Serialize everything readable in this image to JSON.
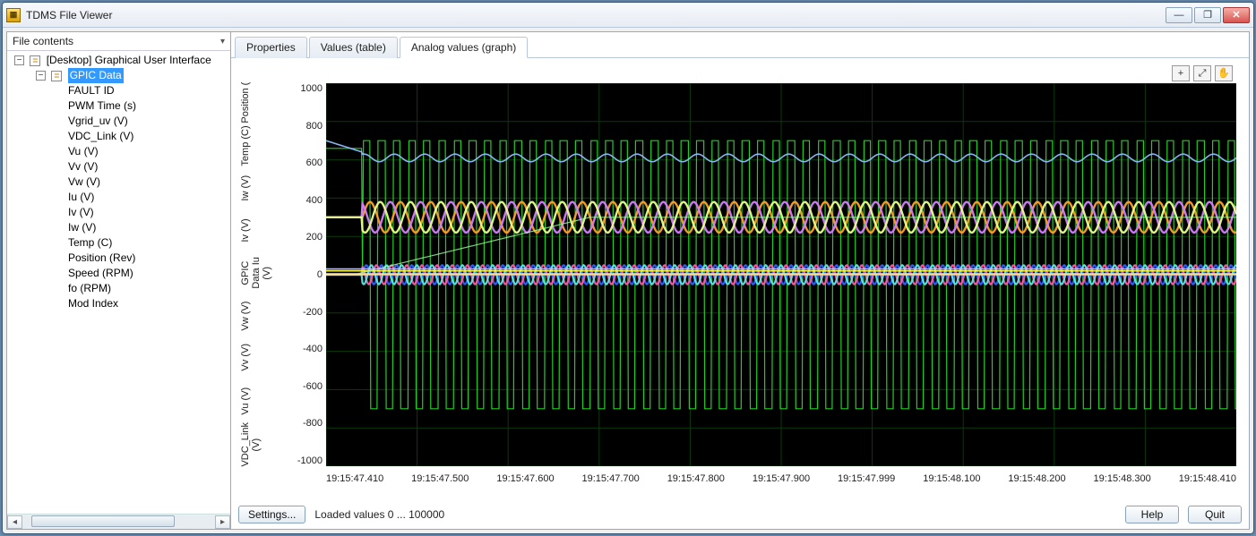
{
  "window": {
    "title": "TDMS File Viewer"
  },
  "sidebar": {
    "header": "File contents",
    "root": {
      "label": "[Desktop] Graphical User Interface"
    },
    "group": {
      "label": "GPIC Data",
      "selected": true
    },
    "leaves": [
      "FAULT ID",
      "PWM Time (s)",
      "Vgrid_uv (V)",
      "VDC_Link (V)",
      "Vu (V)",
      "Vv (V)",
      "Vw (V)",
      "Iu (V)",
      "Iv (V)",
      "Iw (V)",
      "Temp (C)",
      "Position (Rev)",
      "Speed (RPM)",
      "fo (RPM)",
      "Mod Index"
    ]
  },
  "tabs": [
    {
      "label": "Properties",
      "active": false
    },
    {
      "label": "Values (table)",
      "active": false
    },
    {
      "label": "Analog values (graph)",
      "active": true
    }
  ],
  "y_labels": [
    "Position (",
    "Temp (C)",
    "Iw (V)",
    "Iv (V)",
    "GPIC Data  Iu (V)",
    "Vw (V)",
    "Vv (V)",
    "Vu (V)",
    "VDC_Link (V)"
  ],
  "buttons": {
    "settings": "Settings...",
    "help": "Help",
    "quit": "Quit"
  },
  "status": "Loaded values 0 ... 100000",
  "chart_data": {
    "type": "line",
    "title": "",
    "ylim": [
      -1000,
      1000
    ],
    "x_range": [
      "19:15:47.410",
      "19:15:48.410"
    ],
    "x_ticks": [
      "19:15:47.410",
      "19:15:47.500",
      "19:15:47.600",
      "19:15:47.700",
      "19:15:47.800",
      "19:15:47.900",
      "19:15:47.999",
      "19:15:48.100",
      "19:15:48.200",
      "19:15:48.300",
      "19:15:48.410"
    ],
    "y_ticks": [
      1000,
      800,
      600,
      400,
      200,
      0,
      -200,
      -400,
      -600,
      -800,
      -1000
    ],
    "series": [
      {
        "name": "Vgrid_uv (V)",
        "color": "#29d629",
        "shape": "square",
        "amplitude": 700,
        "baseline": 0,
        "freq_hz": 60,
        "note": "large green swings ~±700, transient start ~47.45 settling to periodic"
      },
      {
        "name": "VDC_Link (V)",
        "color": "#8fbfff",
        "shape": "flat",
        "amplitude": 20,
        "baseline": 610,
        "note": "near-flat line ~+600 after initial rise from ~640→600"
      },
      {
        "name": "Vu (V)",
        "color": "#ffa028",
        "shape": "arc",
        "amplitude": 80,
        "baseline": 300,
        "freq_hz": 60
      },
      {
        "name": "Vv (V)",
        "color": "#d77dff",
        "shape": "arc",
        "amplitude": 80,
        "baseline": 300,
        "freq_hz": 60,
        "phase_deg": 120
      },
      {
        "name": "Vw (V)",
        "color": "#e8ff8a",
        "shape": "arc",
        "amplitude": 80,
        "baseline": 300,
        "freq_hz": 60,
        "phase_deg": 240
      },
      {
        "name": "Iu (V)",
        "color": "#3060ff",
        "shape": "sine",
        "amplitude": 50,
        "baseline": 0,
        "freq_hz": 60
      },
      {
        "name": "Iv (V)",
        "color": "#ff5aa8",
        "shape": "sine",
        "amplitude": 50,
        "baseline": 0,
        "freq_hz": 60,
        "phase_deg": 120
      },
      {
        "name": "Iw (V)",
        "color": "#5ce8e8",
        "shape": "sine",
        "amplitude": 50,
        "baseline": 0,
        "freq_hz": 60,
        "phase_deg": 240
      },
      {
        "name": "Temp (C)",
        "color": "#ffff30",
        "shape": "flat",
        "amplitude": 0,
        "baseline": 20
      },
      {
        "name": "Position (Rev)",
        "color": "#70c0ff",
        "shape": "flat",
        "amplitude": 0,
        "baseline": 0
      },
      {
        "name": "Speed (RPM)",
        "color": "#a0ffa0",
        "shape": "ramp",
        "from": 0,
        "to": 300,
        "t0": "19:15:47.44",
        "t1": "19:15:47.70"
      },
      {
        "name": "fo (RPM)",
        "color": "#c0c0ff",
        "shape": "flat",
        "amplitude": 0,
        "baseline": 30
      },
      {
        "name": "Mod Index",
        "color": "#ffc0c0",
        "shape": "flat",
        "amplitude": 0,
        "baseline": 5
      }
    ]
  }
}
